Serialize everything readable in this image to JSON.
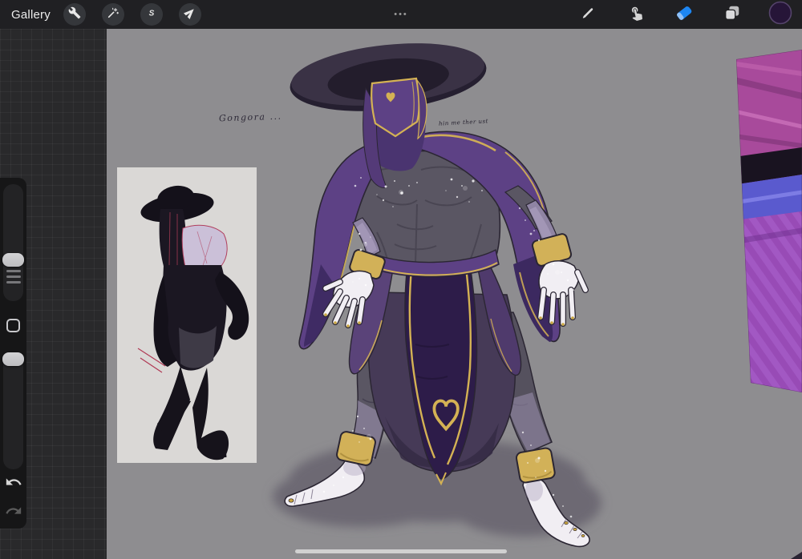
{
  "toolbar": {
    "gallery_label": "Gallery",
    "menu_dots_label": "•••",
    "selection_tool_glyph": "S",
    "tools_left": [
      {
        "id": "actions",
        "icon": "wrench-icon"
      },
      {
        "id": "adjustments",
        "icon": "magic-wand-icon"
      },
      {
        "id": "selection",
        "icon": "selection-s-icon"
      },
      {
        "id": "transform",
        "icon": "transform-arrow-icon"
      }
    ],
    "tools_right": [
      {
        "id": "paint",
        "icon": "paintbrush-icon",
        "active": false
      },
      {
        "id": "smudge",
        "icon": "smudge-finger-icon",
        "active": false
      },
      {
        "id": "erase",
        "icon": "eraser-icon",
        "active": true
      },
      {
        "id": "layers",
        "icon": "layers-icon",
        "active": false
      },
      {
        "id": "color",
        "icon": "color-swatch",
        "active": false
      }
    ],
    "colors": {
      "toolbar_bg": "#202023",
      "icon_circle_bg": "#35373b",
      "eraser_active_blue": "#1d86f2",
      "color_swatch": "#261538"
    }
  },
  "sidebar": {
    "sliders": [
      {
        "id": "brush-size"
      },
      {
        "id": "opacity"
      }
    ],
    "buttons": [
      {
        "id": "modify"
      },
      {
        "id": "undo"
      },
      {
        "id": "redo"
      }
    ]
  },
  "canvas": {
    "background_color": "#8e8d90",
    "annotations": [
      {
        "id": "title-scribble",
        "text": "Gongora ..."
      },
      {
        "id": "small-scribble",
        "text": "hin me ther ust"
      }
    ],
    "artwork_palette": {
      "cloak_purple": "#5d4185",
      "trim_gold": "#d4b254",
      "skin_gray": "#5a5663",
      "hands_feet_white": "#f1eef3",
      "hat_dark": "#3a3245",
      "panel_dark_purple": "#2d1c49",
      "shadow_gray": "#6d6973"
    },
    "reference_image": {
      "background": "#dad8d6"
    },
    "side_photo": {
      "dominant_colors": [
        "#a84a9b",
        "#191320",
        "#5a5ace",
        "#8f42ae"
      ]
    }
  },
  "home_indicator": {
    "color": "#d7d7d7"
  }
}
